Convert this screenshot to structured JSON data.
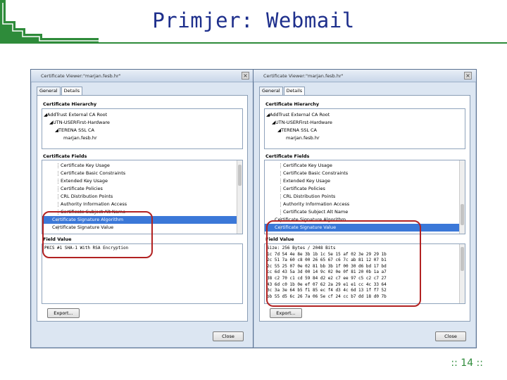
{
  "slide": {
    "title": "Primjer: Webmail",
    "page_number": ":: 14 ::",
    "accent_color": "#2e8b3a",
    "title_color": "#1e2f8c",
    "highlight_color": "#b22222"
  },
  "left_window": {
    "title": "Certificate Viewer:\"marjan.fesb.hr\"",
    "tabs": [
      "General",
      "Details"
    ],
    "hierarchy_label": "Certificate Hierarchy",
    "hierarchy": [
      "◢AddTrust External CA Root",
      "◢UTN-USERFirst-Hardware",
      "◢TERENA SSL CA",
      "marjan.fesb.hr"
    ],
    "fields_label": "Certificate Fields",
    "fields": [
      "Certificate Key Usage",
      "Certificate Basic Constraints",
      "Extended Key Usage",
      "Certificate Policies",
      "CRL Distribution Points",
      "Authority Information Access",
      "Certificate Subject Alt Name",
      "Certificate Signature Algorithm",
      "Certificate Signature Value"
    ],
    "selected_field": "Certificate Signature Algorithm",
    "value_label": "Field Value",
    "value_lines": [
      "PKCS #1 SHA-1 With RSA Encryption"
    ],
    "export_button": "Export...",
    "close_button": "Close"
  },
  "right_window": {
    "title": "Certificate Viewer:\"marjan.fesb.hr\"",
    "tabs": [
      "General",
      "Details"
    ],
    "hierarchy_label": "Certificate Hierarchy",
    "hierarchy": [
      "◢AddTrust External CA Root",
      "◢UTN-USERFirst-Hardware",
      "◢TERENA SSL CA",
      "marjan.fesb.hr"
    ],
    "fields_label": "Certificate Fields",
    "fields": [
      "Certificate Key Usage",
      "Certificate Basic Constraints",
      "Extended Key Usage",
      "Certificate Policies",
      "CRL Distribution Points",
      "Authority Information Access",
      "Certificate Subject Alt Name",
      "Certificate Signature Algorithm",
      "Certificate Signature Value"
    ],
    "selected_field": "Certificate Signature Value",
    "value_label": "Field Value",
    "value_lines": [
      "Size: 256 Bytes / 2048 Bits",
      "1c 7d 54 4e 8e 3b 1b 1c 5e 15 af 02 3e 29 29 1b",
      "2c 51 7a 60 c8 00 26 65 67 c6 7c ab 81 12 07 b1",
      "2c 55 25 07 0e 02 81 bb 3b 1f 00 30 d6 bd 17 bd",
      "cc 6d 43 5a 3d 00 14 9c 02 0e 0f 81 20 0b 1a a7",
      "d8 c2 70 c1 cd 59 84 d2 e2 c7 ee 97 c5 c2 c7 27",
      "43 6d c0 1b 0e ef 07 62 2a 29 e1 e1 cc 4c 33 64",
      "3c 3a 3e 64 b5 f1 85 ec f4 d3 4c 6d 13 1f f7 52",
      "bb 55 d5 6c 26 7a 06 5e cf 24 cc b7 dd 18 d0 7b"
    ],
    "export_button": "Export...",
    "close_button": "Close"
  }
}
